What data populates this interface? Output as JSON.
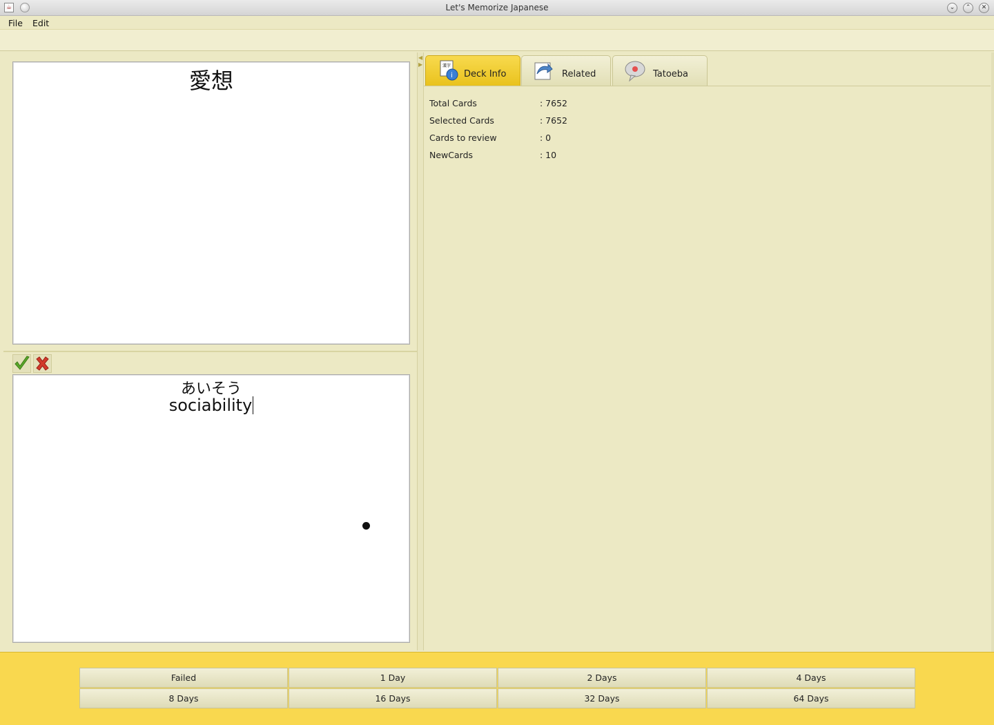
{
  "window": {
    "title": "Let's Memorize Japanese"
  },
  "menu": {
    "file": "File",
    "edit": "Edit"
  },
  "card": {
    "front": "愛想",
    "reading": "あいそう",
    "meaning": "sociability"
  },
  "answer_buttons": {
    "correct_icon": "check-icon",
    "wrong_icon": "cross-icon"
  },
  "tabs": [
    {
      "label": "Deck Info",
      "icon": "deck-info-icon",
      "active": true
    },
    {
      "label": "Related",
      "icon": "related-icon",
      "active": false
    },
    {
      "label": "Tatoeba",
      "icon": "tatoeba-icon",
      "active": false
    }
  ],
  "deck_info": [
    {
      "label": "Total Cards",
      "value": ": 7652"
    },
    {
      "label": "Selected Cards",
      "value": ": 7652"
    },
    {
      "label": "Cards to review",
      "value": ": 0"
    },
    {
      "label": "NewCards",
      "value": ": 10"
    }
  ],
  "intervals": [
    "Failed",
    "1 Day",
    "2 Days",
    "4 Days",
    "8 Days",
    "16 Days",
    "32 Days",
    "64 Days"
  ],
  "colors": {
    "accent": "#f9d84f",
    "active_tab": "#f0cc2e",
    "panel": "#ece9c4"
  }
}
